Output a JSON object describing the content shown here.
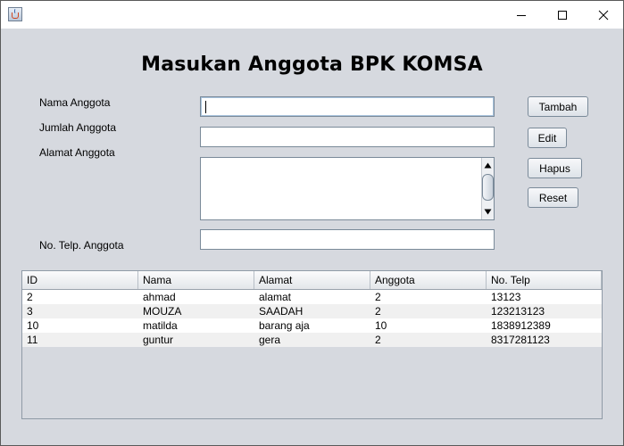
{
  "window": {
    "app_icon": "java-cup-icon",
    "controls": [
      "minimize-icon",
      "maximize-icon",
      "close-icon"
    ]
  },
  "heading": "Masukan Anggota BPK KOMSA",
  "form": {
    "nama_label": "Nama Anggota",
    "nama_value": "",
    "jumlah_label": "Jumlah Anggota",
    "jumlah_value": "",
    "alamat_label": "Alamat Anggota",
    "alamat_value": "",
    "telp_label": "No. Telp. Anggota",
    "telp_value": ""
  },
  "buttons": {
    "tambah": "Tambah",
    "edit": "Edit",
    "hapus": "Hapus",
    "reset": "Reset"
  },
  "table": {
    "columns": [
      "ID",
      "Nama",
      "Alamat",
      "Anggota",
      "No. Telp"
    ],
    "rows": [
      [
        "2",
        "ahmad",
        "alamat",
        "2",
        "13123"
      ],
      [
        "3",
        "MOUZA",
        "SAADAH",
        "2",
        "123213123"
      ],
      [
        "10",
        "matilda",
        "barang aja",
        "10",
        "1838912389"
      ],
      [
        "11",
        "guntur",
        "gera",
        "2",
        "8317281123"
      ]
    ]
  }
}
